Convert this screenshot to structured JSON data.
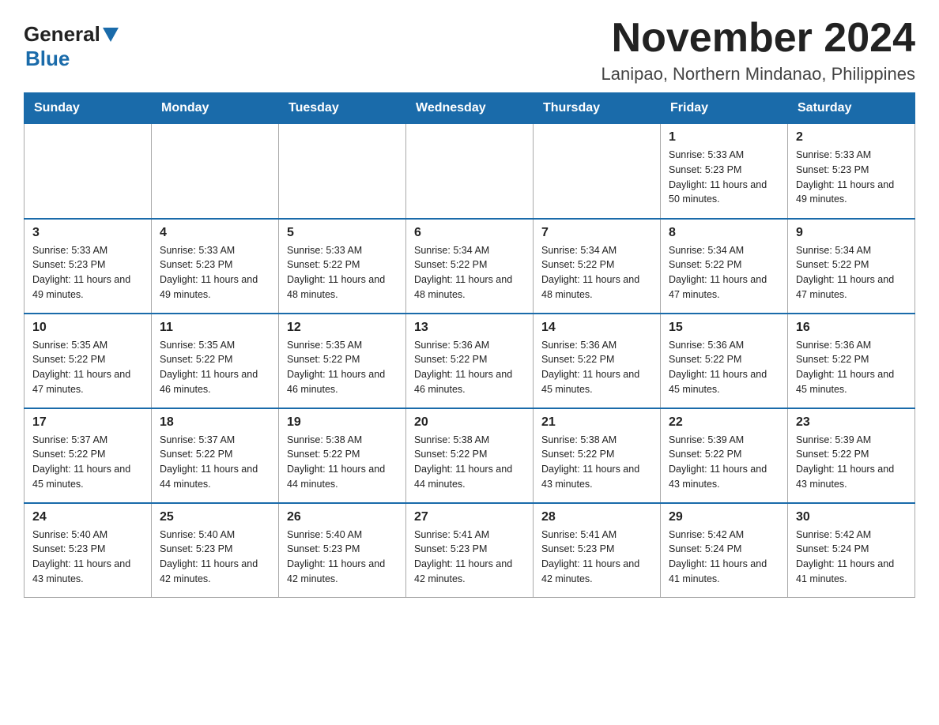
{
  "logo": {
    "general": "General",
    "blue": "Blue"
  },
  "title": "November 2024",
  "subtitle": "Lanipao, Northern Mindanao, Philippines",
  "days_of_week": [
    "Sunday",
    "Monday",
    "Tuesday",
    "Wednesday",
    "Thursday",
    "Friday",
    "Saturday"
  ],
  "weeks": [
    [
      {
        "day": "",
        "sunrise": "",
        "sunset": "",
        "daylight": ""
      },
      {
        "day": "",
        "sunrise": "",
        "sunset": "",
        "daylight": ""
      },
      {
        "day": "",
        "sunrise": "",
        "sunset": "",
        "daylight": ""
      },
      {
        "day": "",
        "sunrise": "",
        "sunset": "",
        "daylight": ""
      },
      {
        "day": "",
        "sunrise": "",
        "sunset": "",
        "daylight": ""
      },
      {
        "day": "1",
        "sunrise": "Sunrise: 5:33 AM",
        "sunset": "Sunset: 5:23 PM",
        "daylight": "Daylight: 11 hours and 50 minutes."
      },
      {
        "day": "2",
        "sunrise": "Sunrise: 5:33 AM",
        "sunset": "Sunset: 5:23 PM",
        "daylight": "Daylight: 11 hours and 49 minutes."
      }
    ],
    [
      {
        "day": "3",
        "sunrise": "Sunrise: 5:33 AM",
        "sunset": "Sunset: 5:23 PM",
        "daylight": "Daylight: 11 hours and 49 minutes."
      },
      {
        "day": "4",
        "sunrise": "Sunrise: 5:33 AM",
        "sunset": "Sunset: 5:23 PM",
        "daylight": "Daylight: 11 hours and 49 minutes."
      },
      {
        "day": "5",
        "sunrise": "Sunrise: 5:33 AM",
        "sunset": "Sunset: 5:22 PM",
        "daylight": "Daylight: 11 hours and 48 minutes."
      },
      {
        "day": "6",
        "sunrise": "Sunrise: 5:34 AM",
        "sunset": "Sunset: 5:22 PM",
        "daylight": "Daylight: 11 hours and 48 minutes."
      },
      {
        "day": "7",
        "sunrise": "Sunrise: 5:34 AM",
        "sunset": "Sunset: 5:22 PM",
        "daylight": "Daylight: 11 hours and 48 minutes."
      },
      {
        "day": "8",
        "sunrise": "Sunrise: 5:34 AM",
        "sunset": "Sunset: 5:22 PM",
        "daylight": "Daylight: 11 hours and 47 minutes."
      },
      {
        "day": "9",
        "sunrise": "Sunrise: 5:34 AM",
        "sunset": "Sunset: 5:22 PM",
        "daylight": "Daylight: 11 hours and 47 minutes."
      }
    ],
    [
      {
        "day": "10",
        "sunrise": "Sunrise: 5:35 AM",
        "sunset": "Sunset: 5:22 PM",
        "daylight": "Daylight: 11 hours and 47 minutes."
      },
      {
        "day": "11",
        "sunrise": "Sunrise: 5:35 AM",
        "sunset": "Sunset: 5:22 PM",
        "daylight": "Daylight: 11 hours and 46 minutes."
      },
      {
        "day": "12",
        "sunrise": "Sunrise: 5:35 AM",
        "sunset": "Sunset: 5:22 PM",
        "daylight": "Daylight: 11 hours and 46 minutes."
      },
      {
        "day": "13",
        "sunrise": "Sunrise: 5:36 AM",
        "sunset": "Sunset: 5:22 PM",
        "daylight": "Daylight: 11 hours and 46 minutes."
      },
      {
        "day": "14",
        "sunrise": "Sunrise: 5:36 AM",
        "sunset": "Sunset: 5:22 PM",
        "daylight": "Daylight: 11 hours and 45 minutes."
      },
      {
        "day": "15",
        "sunrise": "Sunrise: 5:36 AM",
        "sunset": "Sunset: 5:22 PM",
        "daylight": "Daylight: 11 hours and 45 minutes."
      },
      {
        "day": "16",
        "sunrise": "Sunrise: 5:36 AM",
        "sunset": "Sunset: 5:22 PM",
        "daylight": "Daylight: 11 hours and 45 minutes."
      }
    ],
    [
      {
        "day": "17",
        "sunrise": "Sunrise: 5:37 AM",
        "sunset": "Sunset: 5:22 PM",
        "daylight": "Daylight: 11 hours and 45 minutes."
      },
      {
        "day": "18",
        "sunrise": "Sunrise: 5:37 AM",
        "sunset": "Sunset: 5:22 PM",
        "daylight": "Daylight: 11 hours and 44 minutes."
      },
      {
        "day": "19",
        "sunrise": "Sunrise: 5:38 AM",
        "sunset": "Sunset: 5:22 PM",
        "daylight": "Daylight: 11 hours and 44 minutes."
      },
      {
        "day": "20",
        "sunrise": "Sunrise: 5:38 AM",
        "sunset": "Sunset: 5:22 PM",
        "daylight": "Daylight: 11 hours and 44 minutes."
      },
      {
        "day": "21",
        "sunrise": "Sunrise: 5:38 AM",
        "sunset": "Sunset: 5:22 PM",
        "daylight": "Daylight: 11 hours and 43 minutes."
      },
      {
        "day": "22",
        "sunrise": "Sunrise: 5:39 AM",
        "sunset": "Sunset: 5:22 PM",
        "daylight": "Daylight: 11 hours and 43 minutes."
      },
      {
        "day": "23",
        "sunrise": "Sunrise: 5:39 AM",
        "sunset": "Sunset: 5:22 PM",
        "daylight": "Daylight: 11 hours and 43 minutes."
      }
    ],
    [
      {
        "day": "24",
        "sunrise": "Sunrise: 5:40 AM",
        "sunset": "Sunset: 5:23 PM",
        "daylight": "Daylight: 11 hours and 43 minutes."
      },
      {
        "day": "25",
        "sunrise": "Sunrise: 5:40 AM",
        "sunset": "Sunset: 5:23 PM",
        "daylight": "Daylight: 11 hours and 42 minutes."
      },
      {
        "day": "26",
        "sunrise": "Sunrise: 5:40 AM",
        "sunset": "Sunset: 5:23 PM",
        "daylight": "Daylight: 11 hours and 42 minutes."
      },
      {
        "day": "27",
        "sunrise": "Sunrise: 5:41 AM",
        "sunset": "Sunset: 5:23 PM",
        "daylight": "Daylight: 11 hours and 42 minutes."
      },
      {
        "day": "28",
        "sunrise": "Sunrise: 5:41 AM",
        "sunset": "Sunset: 5:23 PM",
        "daylight": "Daylight: 11 hours and 42 minutes."
      },
      {
        "day": "29",
        "sunrise": "Sunrise: 5:42 AM",
        "sunset": "Sunset: 5:24 PM",
        "daylight": "Daylight: 11 hours and 41 minutes."
      },
      {
        "day": "30",
        "sunrise": "Sunrise: 5:42 AM",
        "sunset": "Sunset: 5:24 PM",
        "daylight": "Daylight: 11 hours and 41 minutes."
      }
    ]
  ]
}
